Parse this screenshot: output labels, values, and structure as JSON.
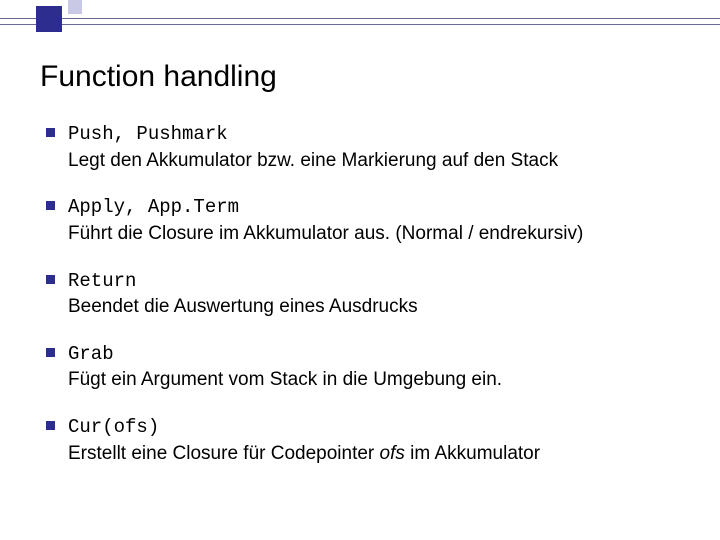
{
  "title": "Function handling",
  "items": [
    {
      "term": "Push, Pushmark",
      "desc": "Legt den Akkumulator bzw. eine Markierung auf den Stack"
    },
    {
      "term": "Apply, App.Term",
      "desc": "Führt die Closure im Akkumulator aus. (Normal / endrekursiv)"
    },
    {
      "term": "Return",
      "desc": "Beendet die Auswertung eines Ausdrucks"
    },
    {
      "term": "Grab",
      "desc": "Fügt ein Argument vom Stack in die Umgebung ein."
    },
    {
      "term": "Cur(ofs)",
      "desc_pre": "Erstellt eine Closure für Codepointer ",
      "desc_em": "ofs",
      "desc_post": " im Akkumulator"
    }
  ]
}
